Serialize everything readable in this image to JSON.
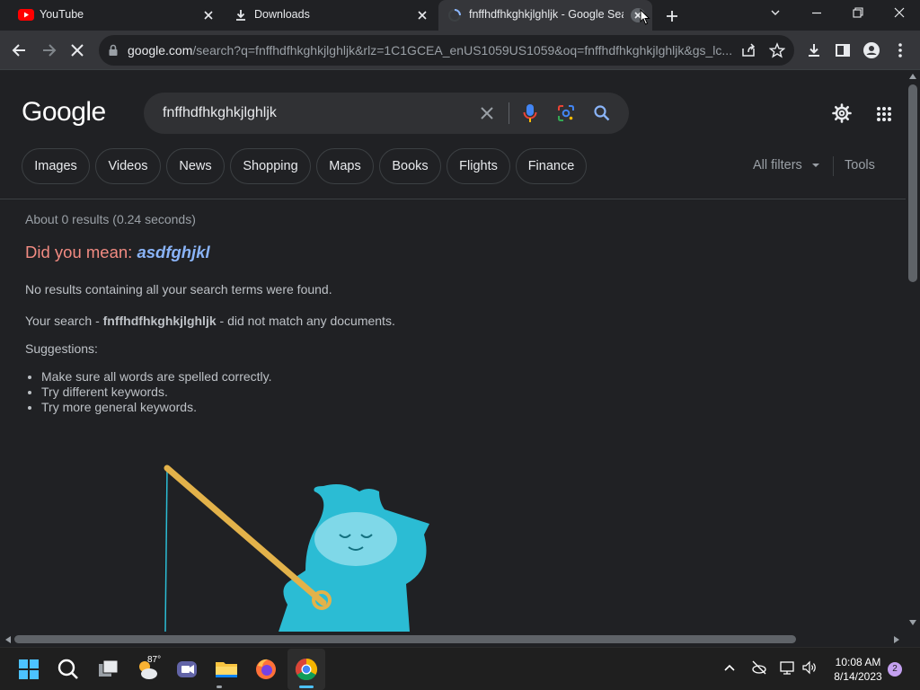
{
  "browser": {
    "tabs": [
      {
        "title": "YouTube",
        "icon": "youtube-icon"
      },
      {
        "title": "Downloads",
        "icon": "download-icon"
      },
      {
        "title": "fnffhdfhkghkjlghljk - Google Search",
        "icon": "loading-icon",
        "active": true
      }
    ],
    "url_host": "google.com",
    "url_rest": "/search?q=fnffhdfhkghkjlghljk&rlz=1C1GCEA_enUS1059US1059&oq=fnffhdfhkghkjlghljk&gs_lc..."
  },
  "google": {
    "logo": "Google",
    "query": "fnffhdfhkghkjlghljk",
    "filters": [
      "Images",
      "Videos",
      "News",
      "Shopping",
      "Maps",
      "Books",
      "Flights",
      "Finance"
    ],
    "all_filters": "All filters",
    "tools": "Tools"
  },
  "results": {
    "stats": "About 0 results (0.24 seconds)",
    "did_you_mean": "Did you mean:",
    "suggestion": "asdfghjkl",
    "no_results": "No results containing all your search terms were found.",
    "search_prefix": "Your search - ",
    "search_term": "fnffhdfhkghkjlghljk",
    "search_suffix": " - did not match any documents.",
    "suggestions_title": "Suggestions:",
    "suggestions": [
      "Make sure all words are spelled correctly.",
      "Try different keywords.",
      "Try more general keywords."
    ]
  },
  "taskbar": {
    "weather_temp": "87°",
    "time": "10:08 AM",
    "date": "8/14/2023",
    "notifications": "2"
  },
  "colors": {
    "background": "#202124",
    "link_blue": "#8ab4f8",
    "did_you_mean_red": "#f28b82",
    "illustration_blue": "#2bbcd4"
  }
}
